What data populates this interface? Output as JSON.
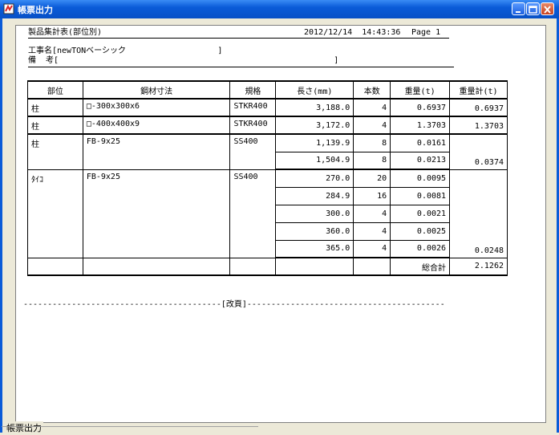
{
  "window": {
    "title": "帳票出力"
  },
  "report": {
    "heading": "製品集計表(部位別)",
    "datetime": "2012/12/14  14:43:36",
    "page": "Page 1",
    "project": "工事名[newTONベーシック                   ]",
    "remarks": "備  考[                                                         ]",
    "headers": [
      "部位",
      "鋼材寸法",
      "規格",
      "長さ(mm)",
      "本数",
      "重量(t)",
      "重量計(t)"
    ],
    "groups": [
      {
        "part": "柱",
        "size": "□-300x300x6",
        "spec": "STKR400",
        "total": "0.6937",
        "rows": [
          {
            "length": "3,188.0",
            "count": "4",
            "weight": "0.6937"
          }
        ]
      },
      {
        "part": "柱",
        "size": "□-400x400x9",
        "spec": "STKR400",
        "total": "1.3703",
        "rows": [
          {
            "length": "3,172.0",
            "count": "4",
            "weight": "1.3703"
          }
        ]
      },
      {
        "part": "柱",
        "size": "FB-9x25",
        "spec": "SS400",
        "total": "0.0374",
        "rows": [
          {
            "length": "1,139.9",
            "count": "8",
            "weight": "0.0161"
          },
          {
            "length": "1,504.9",
            "count": "8",
            "weight": "0.0213"
          }
        ]
      },
      {
        "part": "ﾀｲｺ",
        "size": "FB-9x25",
        "spec": "SS400",
        "total": "0.0248",
        "rows": [
          {
            "length": "270.0",
            "count": "20",
            "weight": "0.0095"
          },
          {
            "length": "284.9",
            "count": "16",
            "weight": "0.0081"
          },
          {
            "length": "300.0",
            "count": "4",
            "weight": "0.0021"
          },
          {
            "length": "360.0",
            "count": "4",
            "weight": "0.0025"
          },
          {
            "length": "365.0",
            "count": "4",
            "weight": "0.0026"
          }
        ]
      }
    ],
    "grand_total_label": "総合計",
    "grand_total": "2.1262",
    "page_break": "-----------------------------------------[改頁]-----------------------------------------"
  },
  "groupbox": {
    "label": "帳票出力"
  }
}
